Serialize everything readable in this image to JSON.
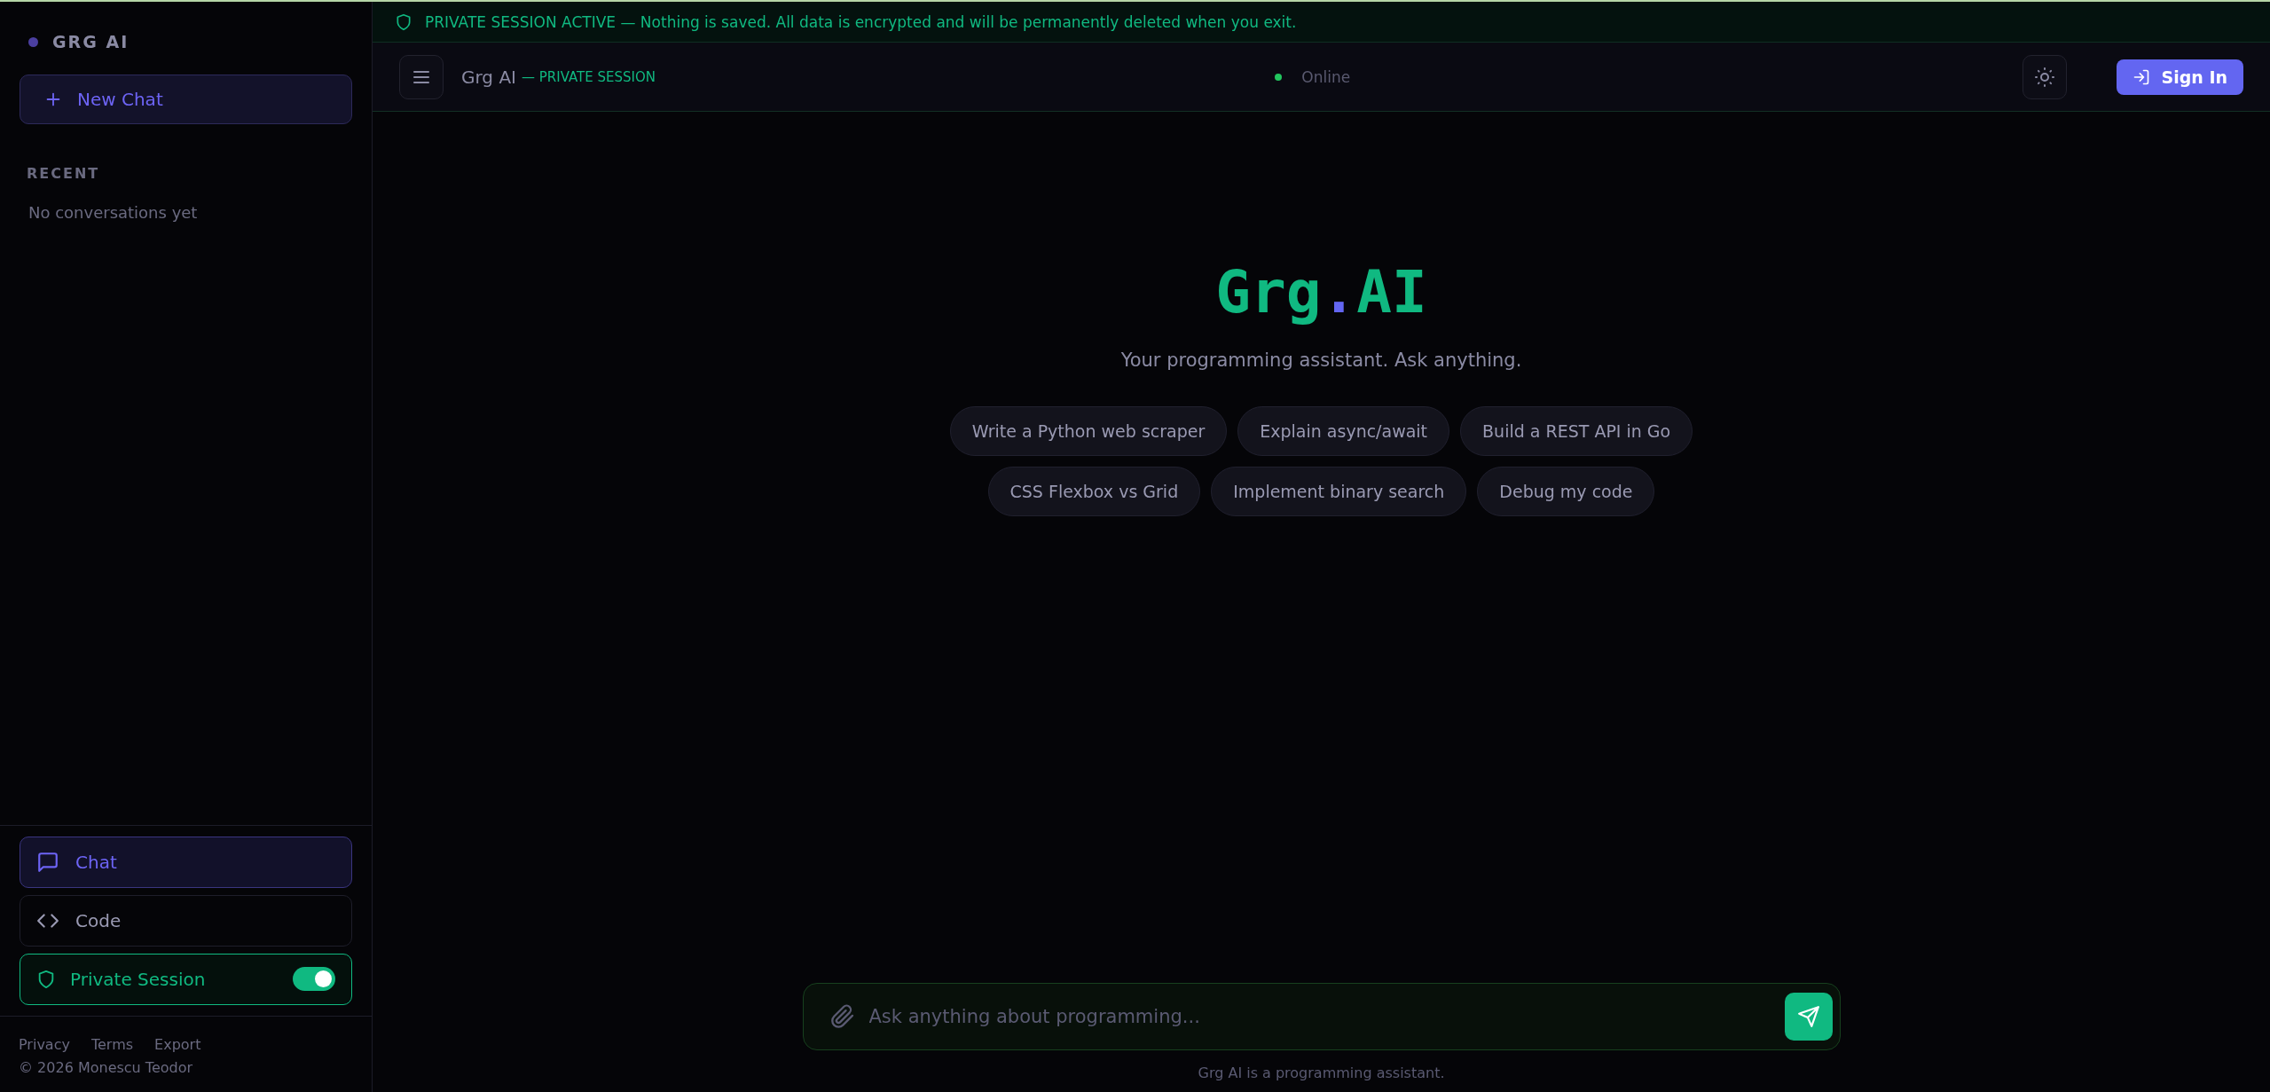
{
  "sidebar": {
    "brand": "GRG AI",
    "new_chat": "New Chat",
    "recent_heading": "RECENT",
    "empty_text": "No conversations yet",
    "nav": [
      {
        "kind": "chat",
        "label": "Chat",
        "selected": true
      },
      {
        "kind": "code",
        "label": "Code",
        "selected": false
      }
    ],
    "private_toggle": {
      "label": "Private Session",
      "on": true
    },
    "footer_links": [
      "Privacy",
      "Terms",
      "Export"
    ],
    "copyright": "© 2026 Monescu Teodor"
  },
  "banner": {
    "title": "PRIVATE SESSION ACTIVE",
    "text": "— Nothing is saved. All data is encrypted and will be permanently deleted when you exit."
  },
  "header": {
    "title": "Grg AI",
    "subtitle": "— PRIVATE SESSION",
    "status": "Online",
    "sign_in": "Sign In"
  },
  "hero": {
    "logo_left": "Grg",
    "logo_dot": ".",
    "logo_right": "AI",
    "tagline": "Your programming assistant. Ask anything.",
    "suggestions": [
      [
        "Write a Python web scraper",
        "Explain async/await",
        "Build a REST API in Go"
      ],
      [
        "CSS Flexbox vs Grid",
        "Implement binary search",
        "Debug my code"
      ]
    ]
  },
  "composer": {
    "placeholder": "Ask anything about programming...",
    "disclaimer": "Grg AI is a programming assistant."
  }
}
